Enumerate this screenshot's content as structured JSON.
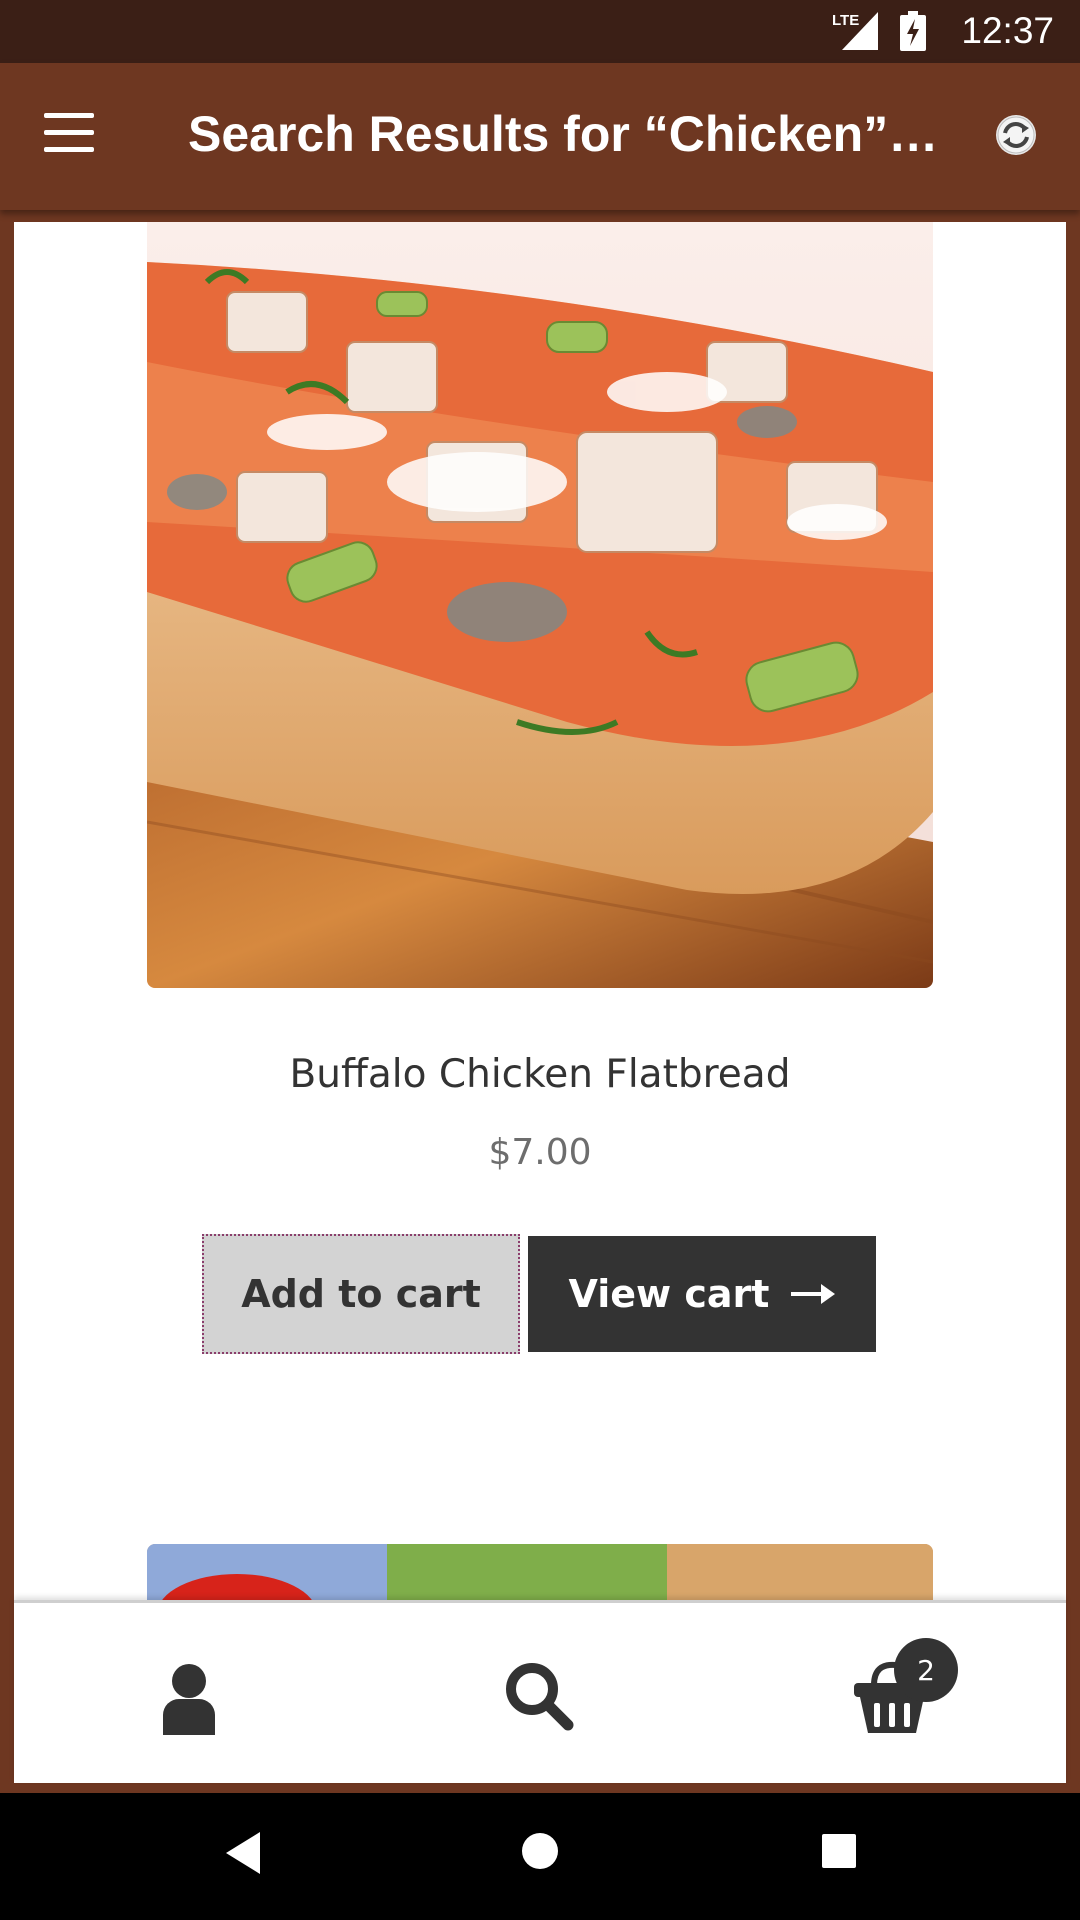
{
  "status_bar": {
    "network": "LTE",
    "time": "12:37"
  },
  "app_bar": {
    "title": "Search Results for “Chicken”…"
  },
  "product": {
    "name": "Buffalo Chicken Flatbread",
    "price": "$7.00",
    "add_to_cart_label": "Add to cart",
    "view_cart_label": "View cart"
  },
  "bottom_nav": {
    "items": [
      {
        "icon": "account-icon"
      },
      {
        "icon": "search-icon"
      },
      {
        "icon": "cart-icon"
      }
    ],
    "cart_count": "2"
  },
  "colors": {
    "brand": "#6e3721",
    "status_bar": "#3b1f16",
    "dark_button": "#333333",
    "light_button": "#d3d3d3"
  }
}
